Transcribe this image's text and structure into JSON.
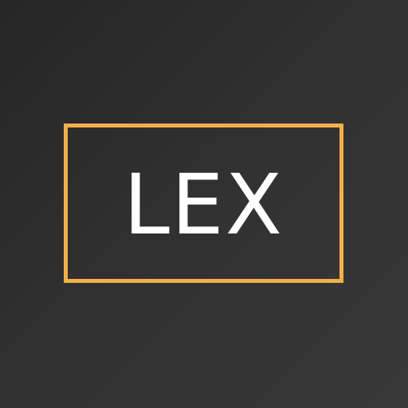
{
  "logo": {
    "text": "LEX",
    "frame_color": "#f2b04a",
    "text_color": "#ffffff",
    "background_color": "#2e2e2e"
  }
}
